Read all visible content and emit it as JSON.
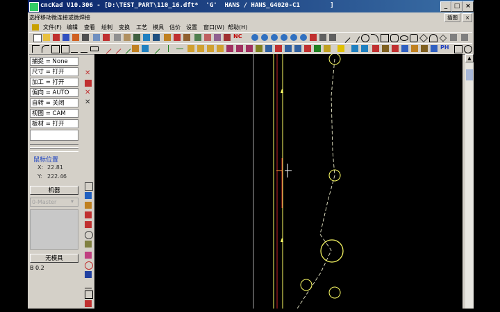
{
  "window": {
    "title": "cncKad V10.306 - [D:\\TEST_PART\\110_16.dft*  'G'  HANS / HANS_G4020-C1        ]",
    "hint": "选择移动微连接或微焊接",
    "controls": [
      "_",
      "□",
      "×"
    ],
    "right_buttons": [
      "插图",
      "×"
    ]
  },
  "menu": {
    "items": [
      "文件(F)",
      "编辑",
      "查看",
      "绘制",
      "变换",
      "工艺",
      "模具",
      "估价",
      "设置",
      "窗口(W)",
      "帮助(H)"
    ],
    "nc_label": "NC",
    "ph_label": "PH"
  },
  "settings": [
    {
      "label": "捕捉 = None"
    },
    {
      "label": "尺寸 = 打开"
    },
    {
      "label": "加工 = 打开"
    },
    {
      "label": "偏向 = AUTO"
    },
    {
      "label": "自转 = 关闭"
    },
    {
      "label": "视图 = CAM"
    },
    {
      "label": "板材 = 打开"
    }
  ],
  "mouse": {
    "title": "鼠标位置",
    "x_label": "X:",
    "x_value": "22.81",
    "y_label": "Y:",
    "y_value": "222.46"
  },
  "machine_button": "机器",
  "dropdown_value": "0-Master",
  "no_tool_button": "无模具",
  "tool_info": "B 0.2",
  "colors": {
    "title_bar": "#0a246a",
    "canvas_bg": "#000000",
    "vertical_line": "#ffff66",
    "red_line": "#ff3030",
    "dashed_path": "#e8e8c8"
  }
}
